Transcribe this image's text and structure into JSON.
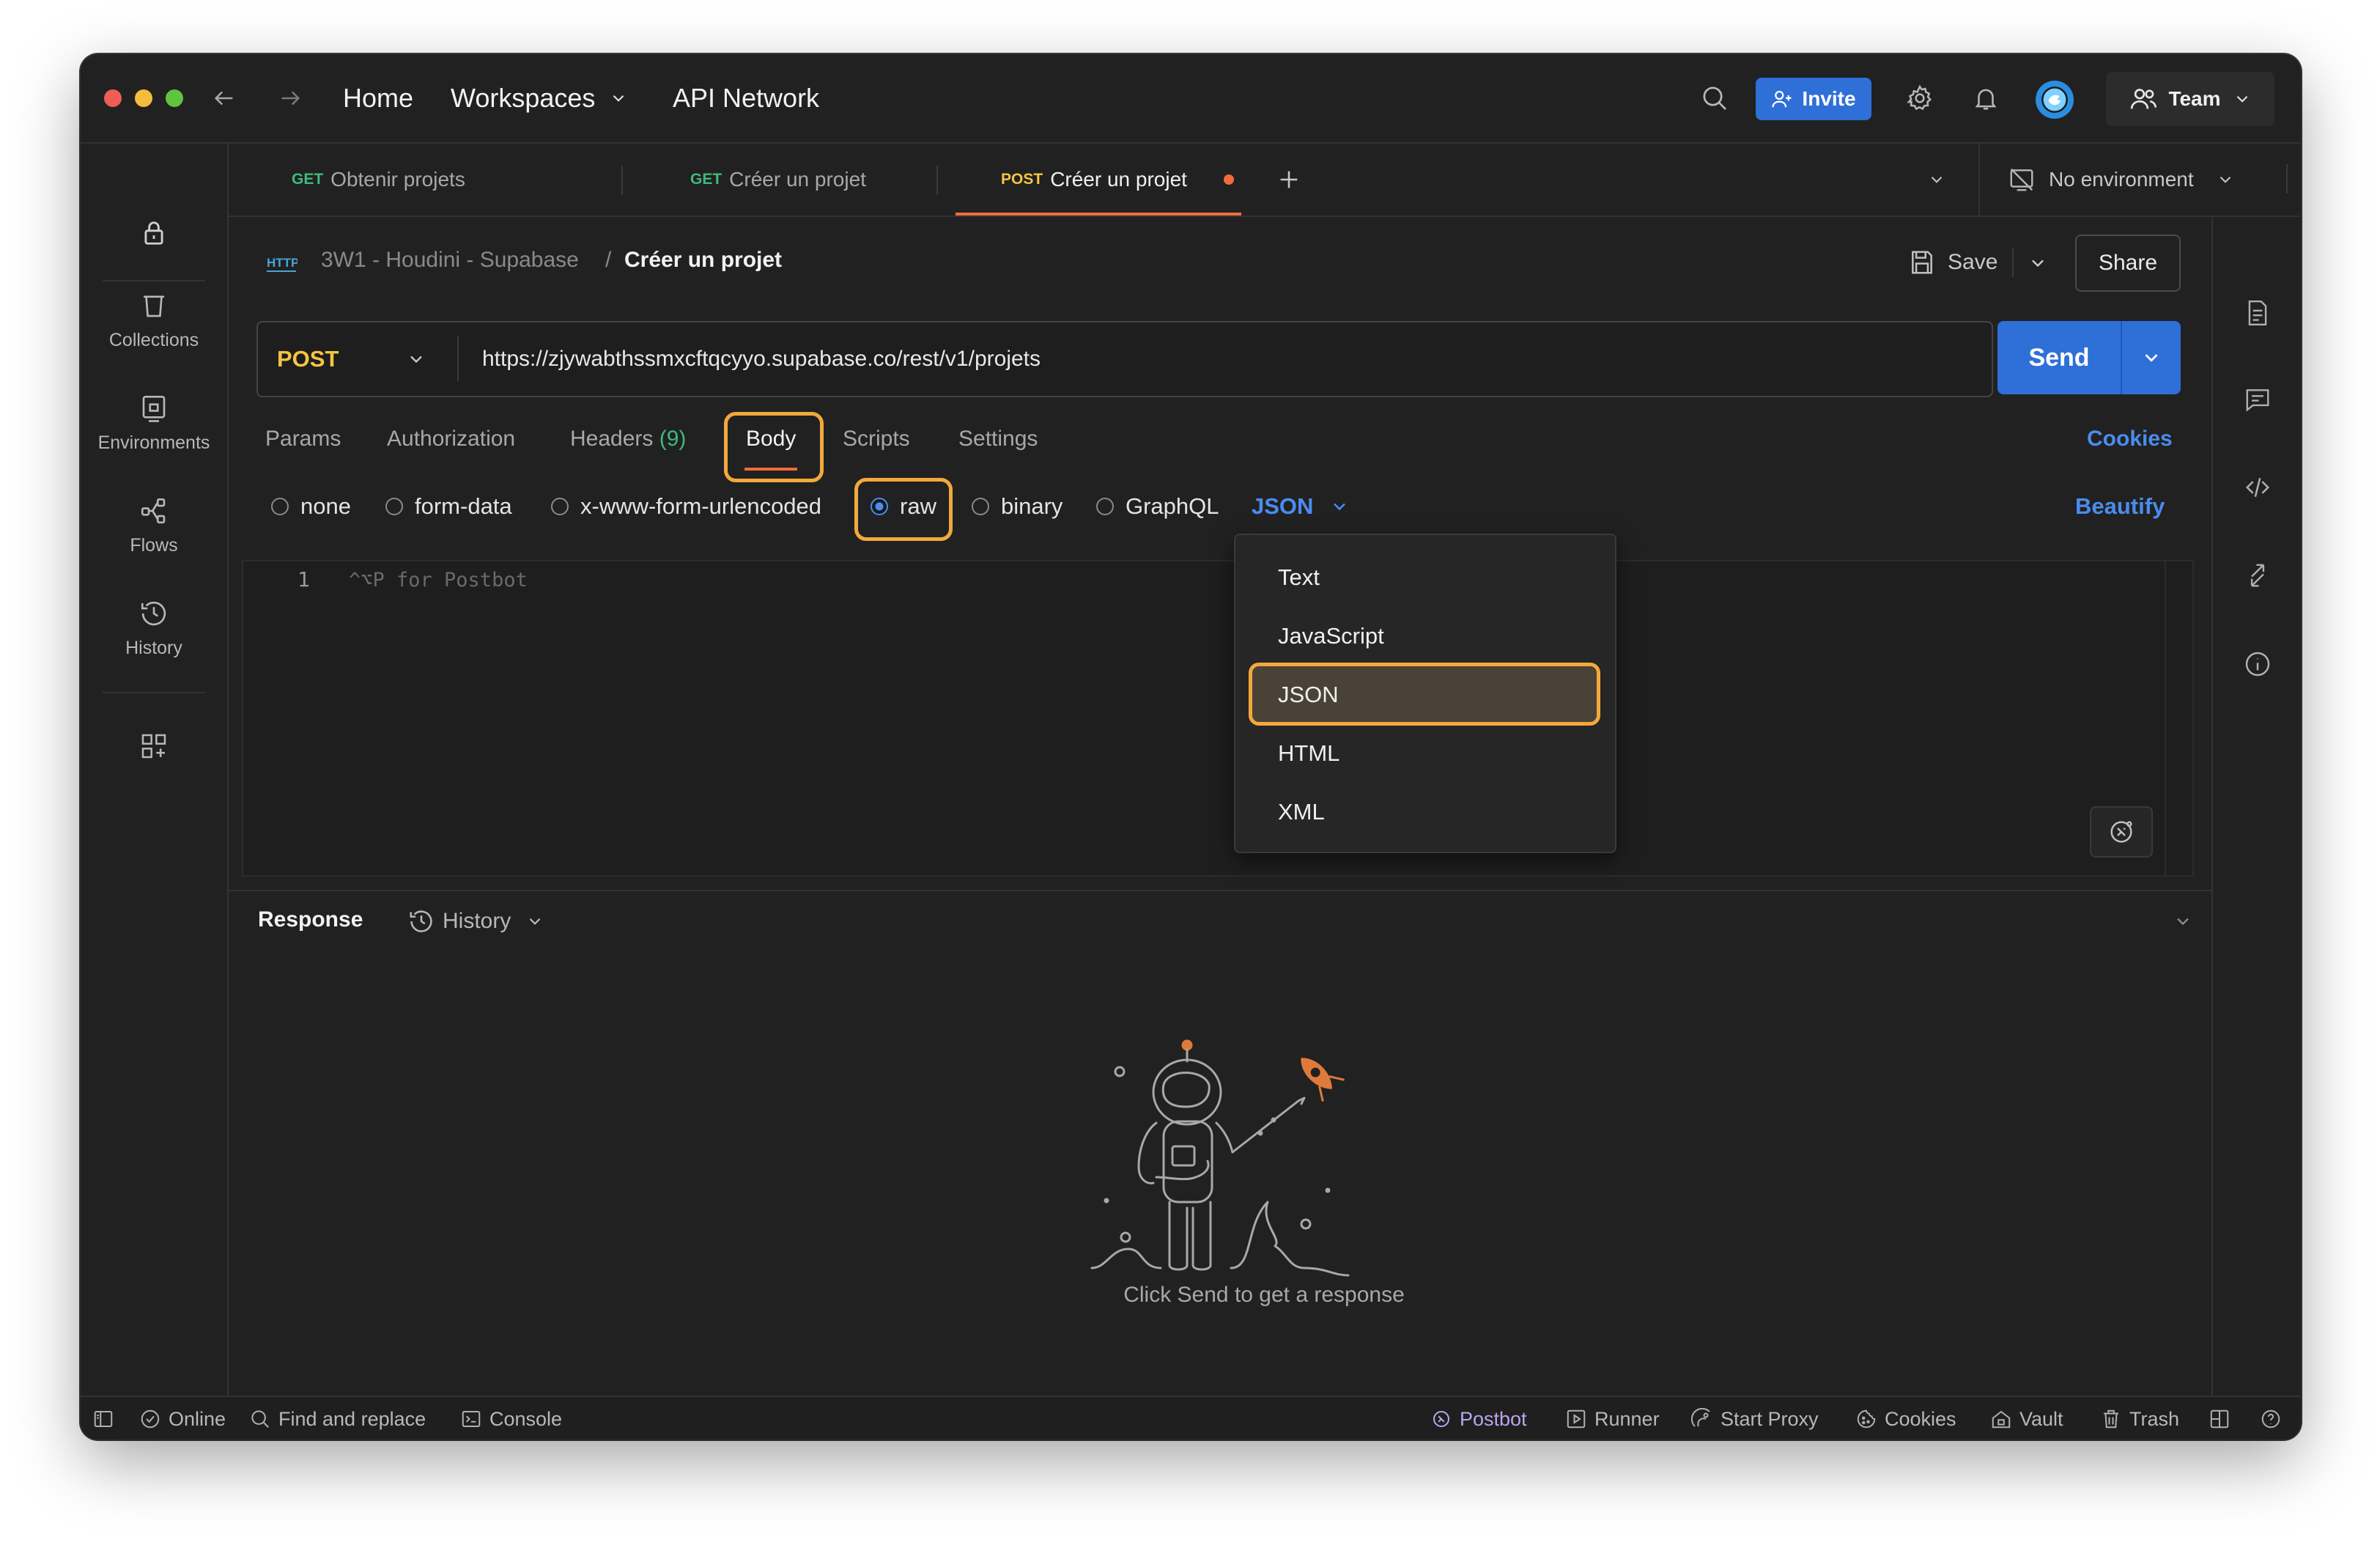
{
  "titlebar": {
    "nav": {
      "home": "Home",
      "workspaces": "Workspaces",
      "api_network": "API Network"
    },
    "invite_label": "Invite",
    "team_label": "Team"
  },
  "rail": {
    "items": [
      {
        "label": "Collections",
        "icon": "trash-can-icon"
      },
      {
        "label": "Environments",
        "icon": "environment-icon"
      },
      {
        "label": "Flows",
        "icon": "flows-icon"
      },
      {
        "label": "History",
        "icon": "history-icon"
      }
    ]
  },
  "tabs": [
    {
      "method": "GET",
      "name": "Obtenir projets"
    },
    {
      "method": "GET",
      "name": "Créer un projet"
    },
    {
      "method": "POST",
      "name": "Créer un projet",
      "active": true,
      "unsaved": true
    }
  ],
  "environment": {
    "label": "No environment"
  },
  "breadcrumb": {
    "badge": "HTTP",
    "collection": "3W1 - Houdini - Supabase",
    "separator": "/",
    "request": "Créer un projet"
  },
  "actions": {
    "save_label": "Save",
    "share_label": "Share"
  },
  "request": {
    "method": "POST",
    "url": "https://zjywabthssmxcftqcyyo.supabase.co/rest/v1/projets",
    "send_label": "Send"
  },
  "subtabs": {
    "params": "Params",
    "authorization": "Authorization",
    "headers": "Headers",
    "headers_count": "(9)",
    "body": "Body",
    "scripts": "Scripts",
    "settings": "Settings",
    "cookies": "Cookies"
  },
  "body_modes": {
    "options": [
      "none",
      "form-data",
      "x-www-form-urlencoded",
      "raw",
      "binary",
      "GraphQL"
    ],
    "selected": "raw",
    "format": "JSON",
    "beautify": "Beautify"
  },
  "editor": {
    "line_number": "1",
    "placeholder": "^⌥P for Postbot"
  },
  "format_dropdown": {
    "options": [
      "Text",
      "JavaScript",
      "JSON",
      "HTML",
      "XML"
    ],
    "selected": "JSON"
  },
  "response": {
    "title": "Response",
    "history_label": "History",
    "empty_message": "Click Send to get a response"
  },
  "statusbar": {
    "online": "Online",
    "find_replace": "Find and replace",
    "console": "Console",
    "postbot": "Postbot",
    "runner": "Runner",
    "start_proxy": "Start Proxy",
    "cookies": "Cookies",
    "vault": "Vault",
    "trash": "Trash"
  },
  "colors": {
    "accent_blue": "#2f6fd8",
    "highlight_orange": "#f2a93b",
    "method_post": "#f5c542",
    "method_get": "#3fb97c",
    "window_bg": "#212121"
  }
}
